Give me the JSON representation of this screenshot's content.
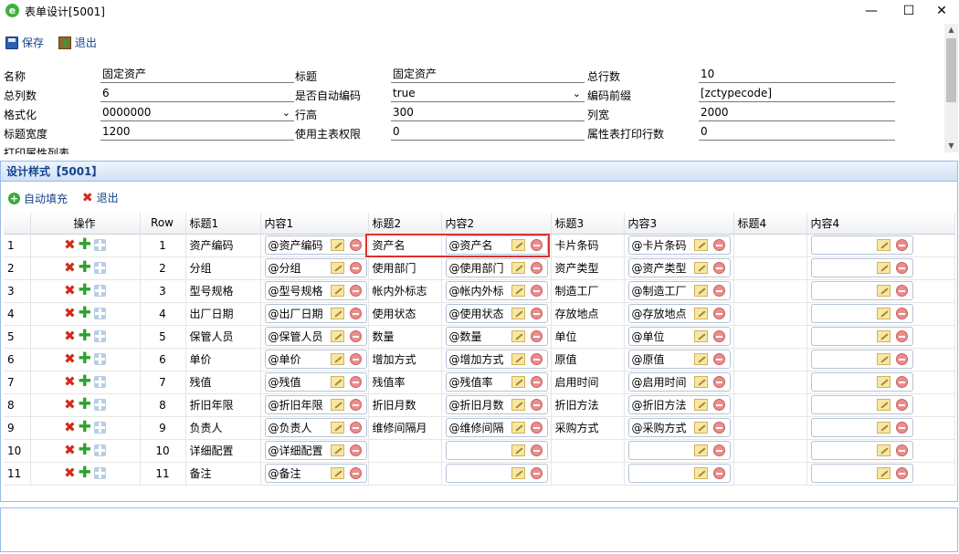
{
  "window": {
    "title": "表单设计[5001]",
    "minimize": "—",
    "maximize": "☐",
    "close": "✕"
  },
  "toolbar": {
    "save": "保存",
    "exit": "退出"
  },
  "form": {
    "row1": {
      "l1": "名称",
      "v1": "固定资产",
      "l2": "标题",
      "v2": "固定资产",
      "l3": "总行数",
      "v3": "10"
    },
    "row2": {
      "l1": "总列数",
      "v1": "6",
      "l2": "是否自动编码",
      "v2": "true",
      "l3": "编码前缀",
      "v3": "[zctypecode]"
    },
    "row3": {
      "l1": "格式化",
      "v1": "0000000",
      "l2": "行高",
      "v2": "300",
      "l3": "列宽",
      "v3": "2000"
    },
    "row4": {
      "l1": "标题宽度",
      "v1": "1200",
      "l2": "使用主表权限",
      "v2": "0",
      "l3": "属性表打印行数",
      "v3": "0"
    },
    "row5": {
      "l1": "打印属性列表"
    }
  },
  "panel": {
    "title": "设计样式【5001】",
    "auto_fill": "自动填充",
    "exit": "退出",
    "headers": [
      "",
      "操作",
      "Row",
      "标题1",
      "内容1",
      "标题2",
      "内容2",
      "标题3",
      "内容3",
      "标题4",
      "内容4"
    ],
    "rows": [
      {
        "n": "1",
        "row": "1",
        "t1": "资产编码",
        "c1": "@资产编码",
        "t2": "资产名",
        "c2": "@资产名",
        "t3": "卡片条码",
        "c3": "@卡片条码",
        "t4": "",
        "c4": ""
      },
      {
        "n": "2",
        "row": "2",
        "t1": "分组",
        "c1": "@分组",
        "t2": "使用部门",
        "c2": "@使用部门",
        "t3": "资产类型",
        "c3": "@资产类型",
        "t4": "",
        "c4": ""
      },
      {
        "n": "3",
        "row": "3",
        "t1": "型号规格",
        "c1": "@型号规格",
        "t2": "帐内外标志",
        "c2": "@帐内外标",
        "t3": "制造工厂",
        "c3": "@制造工厂",
        "t4": "",
        "c4": ""
      },
      {
        "n": "4",
        "row": "4",
        "t1": "出厂日期",
        "c1": "@出厂日期",
        "t2": "使用状态",
        "c2": "@使用状态",
        "t3": "存放地点",
        "c3": "@存放地点",
        "t4": "",
        "c4": ""
      },
      {
        "n": "5",
        "row": "5",
        "t1": "保管人员",
        "c1": "@保管人员",
        "t2": "数量",
        "c2": "@数量",
        "t3": "单位",
        "c3": "@单位",
        "t4": "",
        "c4": ""
      },
      {
        "n": "6",
        "row": "6",
        "t1": "单价",
        "c1": "@单价",
        "t2": "增加方式",
        "c2": "@增加方式",
        "t3": "原值",
        "c3": "@原值",
        "t4": "",
        "c4": ""
      },
      {
        "n": "7",
        "row": "7",
        "t1": "残值",
        "c1": "@残值",
        "t2": "残值率",
        "c2": "@残值率",
        "t3": "启用时间",
        "c3": "@启用时间",
        "t4": "",
        "c4": ""
      },
      {
        "n": "8",
        "row": "8",
        "t1": "折旧年限",
        "c1": "@折旧年限",
        "t2": "折旧月数",
        "c2": "@折旧月数",
        "t3": "折旧方法",
        "c3": "@折旧方法",
        "t4": "",
        "c4": ""
      },
      {
        "n": "9",
        "row": "9",
        "t1": "负责人",
        "c1": "@负责人",
        "t2": "维修间隔月",
        "c2": "@维修间隔",
        "t3": "采购方式",
        "c3": "@采购方式",
        "t4": "",
        "c4": ""
      },
      {
        "n": "10",
        "row": "10",
        "t1": "详细配置",
        "c1": "@详细配置",
        "t2": "",
        "c2": "",
        "t3": "",
        "c3": "",
        "t4": "",
        "c4": ""
      },
      {
        "n": "11",
        "row": "11",
        "t1": "备注",
        "c1": "@备注",
        "t2": "",
        "c2": "",
        "t3": "",
        "c3": "",
        "t4": "",
        "c4": ""
      }
    ]
  },
  "colors": {
    "accent": "#15428b",
    "border": "#99bbe8",
    "highlight": "#e0302b"
  }
}
